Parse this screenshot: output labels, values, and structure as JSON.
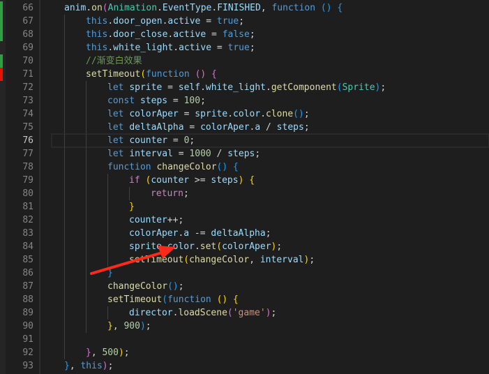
{
  "editor": {
    "line_numbers": [
      "66",
      "67",
      "68",
      "69",
      "70",
      "71",
      "72",
      "73",
      "74",
      "75",
      "76",
      "77",
      "78",
      "79",
      "80",
      "81",
      "82",
      "83",
      "84",
      "85",
      "86",
      "87",
      "88",
      "89",
      "90",
      "91",
      "92",
      "93"
    ],
    "active_line": "76",
    "lines": [
      {
        "indent": 3,
        "tokens": [
          [
            "var",
            "anim"
          ],
          [
            "pun",
            "."
          ],
          [
            "fn",
            "on"
          ],
          [
            "br1",
            "("
          ],
          [
            "cls",
            "Animation"
          ],
          [
            "pun",
            "."
          ],
          [
            "var",
            "EventType"
          ],
          [
            "pun",
            "."
          ],
          [
            "var",
            "FINISHED"
          ],
          [
            "pun",
            ", "
          ],
          [
            "kw",
            "function"
          ],
          [
            "pun",
            " "
          ],
          [
            "br2",
            "()"
          ],
          [
            "pun",
            " "
          ],
          [
            "br2",
            "{"
          ]
        ]
      },
      {
        "indent": 4,
        "tokens": [
          [
            "kw",
            "this"
          ],
          [
            "pun",
            "."
          ],
          [
            "var",
            "door_open"
          ],
          [
            "pun",
            "."
          ],
          [
            "var",
            "active"
          ],
          [
            "pun",
            " = "
          ],
          [
            "kw",
            "true"
          ],
          [
            "pun",
            ";"
          ]
        ]
      },
      {
        "indent": 4,
        "tokens": [
          [
            "kw",
            "this"
          ],
          [
            "pun",
            "."
          ],
          [
            "var",
            "door_close"
          ],
          [
            "pun",
            "."
          ],
          [
            "var",
            "active"
          ],
          [
            "pun",
            " = "
          ],
          [
            "kw",
            "false"
          ],
          [
            "pun",
            ";"
          ]
        ]
      },
      {
        "indent": 4,
        "tokens": [
          [
            "kw",
            "this"
          ],
          [
            "pun",
            "."
          ],
          [
            "var",
            "white_light"
          ],
          [
            "pun",
            "."
          ],
          [
            "var",
            "active"
          ],
          [
            "pun",
            " = "
          ],
          [
            "kw",
            "true"
          ],
          [
            "pun",
            ";"
          ]
        ]
      },
      {
        "indent": 4,
        "tokens": [
          [
            "cmt",
            "//渐变白效果"
          ]
        ]
      },
      {
        "indent": 4,
        "tokens": [
          [
            "fn",
            "setTimeout"
          ],
          [
            "br3",
            "("
          ],
          [
            "kw",
            "function"
          ],
          [
            "pun",
            " "
          ],
          [
            "br1",
            "()"
          ],
          [
            "pun",
            " "
          ],
          [
            "br1",
            "{"
          ]
        ]
      },
      {
        "indent": 5,
        "tokens": [
          [
            "kw",
            "let"
          ],
          [
            "pun",
            " "
          ],
          [
            "var",
            "sprite"
          ],
          [
            "pun",
            " = "
          ],
          [
            "var",
            "self"
          ],
          [
            "pun",
            "."
          ],
          [
            "var",
            "white_light"
          ],
          [
            "pun",
            "."
          ],
          [
            "fn",
            "getComponent"
          ],
          [
            "br2",
            "("
          ],
          [
            "cls",
            "Sprite"
          ],
          [
            "br2",
            ")"
          ],
          [
            "pun",
            ";"
          ]
        ]
      },
      {
        "indent": 5,
        "tokens": [
          [
            "kw",
            "const"
          ],
          [
            "pun",
            " "
          ],
          [
            "var",
            "steps"
          ],
          [
            "pun",
            " = "
          ],
          [
            "num",
            "100"
          ],
          [
            "pun",
            ";"
          ]
        ]
      },
      {
        "indent": 5,
        "tokens": [
          [
            "kw",
            "let"
          ],
          [
            "pun",
            " "
          ],
          [
            "var",
            "colorAper"
          ],
          [
            "pun",
            " = "
          ],
          [
            "var",
            "sprite"
          ],
          [
            "pun",
            "."
          ],
          [
            "var",
            "color"
          ],
          [
            "pun",
            "."
          ],
          [
            "fn",
            "clone"
          ],
          [
            "br2",
            "()"
          ],
          [
            "pun",
            ";"
          ]
        ]
      },
      {
        "indent": 5,
        "tokens": [
          [
            "kw",
            "let"
          ],
          [
            "pun",
            " "
          ],
          [
            "var",
            "deltaAlpha"
          ],
          [
            "pun",
            " = "
          ],
          [
            "var",
            "colorAper"
          ],
          [
            "pun",
            "."
          ],
          [
            "var",
            "a"
          ],
          [
            "pun",
            " / "
          ],
          [
            "var",
            "steps"
          ],
          [
            "pun",
            ";"
          ]
        ]
      },
      {
        "indent": 5,
        "tokens": [
          [
            "kw",
            "let"
          ],
          [
            "pun",
            " "
          ],
          [
            "var",
            "counter"
          ],
          [
            "pun",
            " = "
          ],
          [
            "num",
            "0"
          ],
          [
            "pun",
            ";"
          ]
        ]
      },
      {
        "indent": 5,
        "tokens": [
          [
            "kw",
            "let"
          ],
          [
            "pun",
            " "
          ],
          [
            "var",
            "interval"
          ],
          [
            "pun",
            " = "
          ],
          [
            "num",
            "1000"
          ],
          [
            "pun",
            " / "
          ],
          [
            "var",
            "steps"
          ],
          [
            "pun",
            ";"
          ]
        ]
      },
      {
        "indent": 5,
        "tokens": [
          [
            "kw",
            "function"
          ],
          [
            "pun",
            " "
          ],
          [
            "fn",
            "changeColor"
          ],
          [
            "br2",
            "()"
          ],
          [
            "pun",
            " "
          ],
          [
            "br2",
            "{"
          ]
        ]
      },
      {
        "indent": 6,
        "tokens": [
          [
            "ctl",
            "if"
          ],
          [
            "pun",
            " "
          ],
          [
            "br3",
            "("
          ],
          [
            "var",
            "counter"
          ],
          [
            "pun",
            " >= "
          ],
          [
            "var",
            "steps"
          ],
          [
            "br3",
            ")"
          ],
          [
            "pun",
            " "
          ],
          [
            "br3",
            "{"
          ]
        ]
      },
      {
        "indent": 7,
        "tokens": [
          [
            "ctl",
            "return"
          ],
          [
            "pun",
            ";"
          ]
        ]
      },
      {
        "indent": 6,
        "tokens": [
          [
            "br3",
            "}"
          ]
        ]
      },
      {
        "indent": 6,
        "tokens": [
          [
            "var",
            "counter"
          ],
          [
            "pun",
            "++;"
          ]
        ]
      },
      {
        "indent": 6,
        "tokens": [
          [
            "var",
            "colorAper"
          ],
          [
            "pun",
            "."
          ],
          [
            "var",
            "a"
          ],
          [
            "pun",
            " -= "
          ],
          [
            "var",
            "deltaAlpha"
          ],
          [
            "pun",
            ";"
          ]
        ]
      },
      {
        "indent": 6,
        "tokens": [
          [
            "var",
            "sprite"
          ],
          [
            "pun",
            "."
          ],
          [
            "var",
            "color"
          ],
          [
            "pun",
            "."
          ],
          [
            "fn",
            "set"
          ],
          [
            "br3",
            "("
          ],
          [
            "var",
            "colorAper"
          ],
          [
            "br3",
            ")"
          ],
          [
            "pun",
            ";"
          ]
        ]
      },
      {
        "indent": 6,
        "tokens": [
          [
            "fn",
            "setTimeout"
          ],
          [
            "br3",
            "("
          ],
          [
            "fn",
            "changeColor"
          ],
          [
            "pun",
            ", "
          ],
          [
            "var",
            "interval"
          ],
          [
            "br3",
            ")"
          ],
          [
            "pun",
            ";"
          ]
        ]
      },
      {
        "indent": 5,
        "tokens": [
          [
            "br2",
            "}"
          ]
        ]
      },
      {
        "indent": 5,
        "tokens": [
          [
            "fn",
            "changeColor"
          ],
          [
            "br2",
            "()"
          ],
          [
            "pun",
            ";"
          ]
        ]
      },
      {
        "indent": 5,
        "tokens": [
          [
            "fn",
            "setTimeout"
          ],
          [
            "br2",
            "("
          ],
          [
            "kw",
            "function"
          ],
          [
            "pun",
            " "
          ],
          [
            "br3",
            "()"
          ],
          [
            "pun",
            " "
          ],
          [
            "br3",
            "{"
          ]
        ]
      },
      {
        "indent": 6,
        "tokens": [
          [
            "var",
            "director"
          ],
          [
            "pun",
            "."
          ],
          [
            "fn",
            "loadScene"
          ],
          [
            "br1",
            "("
          ],
          [
            "str",
            "'game'"
          ],
          [
            "br1",
            ")"
          ],
          [
            "pun",
            ";"
          ]
        ]
      },
      {
        "indent": 5,
        "tokens": [
          [
            "br3",
            "}"
          ],
          [
            "pun",
            ", "
          ],
          [
            "num",
            "900"
          ],
          [
            "br2",
            ")"
          ],
          [
            "pun",
            ";"
          ]
        ]
      },
      {
        "indent": 4,
        "tokens": []
      },
      {
        "indent": 4,
        "tokens": [
          [
            "br1",
            "}"
          ],
          [
            "pun",
            ", "
          ],
          [
            "num",
            "500"
          ],
          [
            "br3",
            ")"
          ],
          [
            "pun",
            ";"
          ]
        ]
      },
      {
        "indent": 3,
        "tokens": [
          [
            "br2",
            "}"
          ],
          [
            "pun",
            ", "
          ],
          [
            "kw",
            "this"
          ],
          [
            "br1",
            ")"
          ],
          [
            "pun",
            ";"
          ]
        ]
      }
    ],
    "gutter_marks": [
      {
        "line": "66",
        "color": "#2ea043"
      },
      {
        "line": "67",
        "color": "#2ea043"
      },
      {
        "line": "68",
        "color": "#2ea043"
      },
      {
        "line": "70",
        "color": "#2ea043"
      },
      {
        "line": "71",
        "color": "#e51400"
      }
    ]
  },
  "annotation": {
    "arrow_color": "#ff2a1a",
    "points_to_line": "84"
  }
}
